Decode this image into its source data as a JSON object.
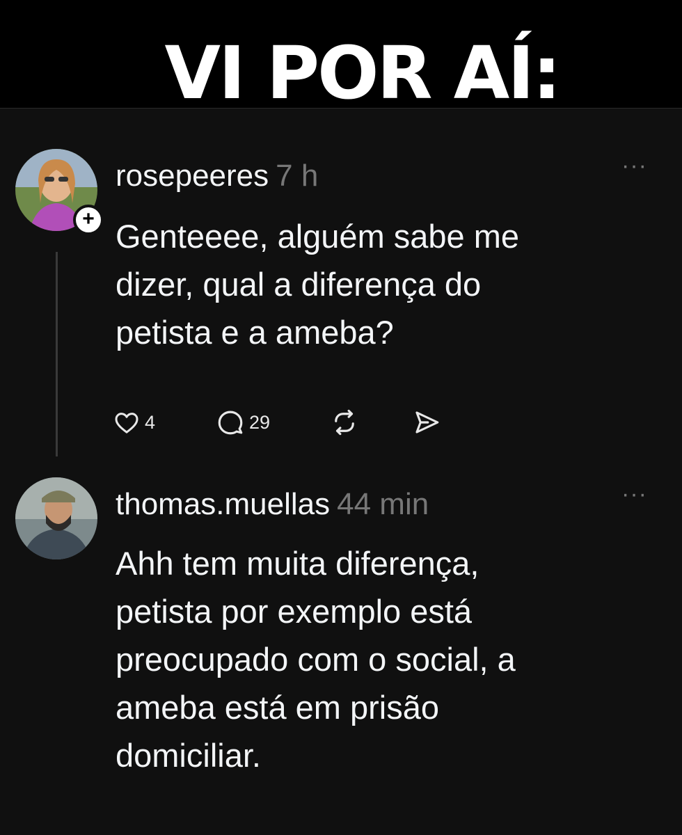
{
  "banner": {
    "title": "VI POR AÍ:"
  },
  "posts": [
    {
      "username": "rosepeeres",
      "time": "7 h",
      "text": "Genteeee, alguém sabe me dizer, qual a diferença do petista e a ameba?",
      "lines": [
        "Genteeee, alguém sabe me",
        "dizer, qual a diferença do",
        "petista e a ameba?"
      ],
      "likes": "4",
      "replies": "29",
      "follow_badge": "+",
      "more": "···"
    },
    {
      "username": "thomas.muellas",
      "time": "44 min",
      "lines": [
        "Ahh tem muita diferença,",
        "petista por exemplo está",
        "preocupado com o social, a",
        "ameba está em prisão",
        "domiciliar."
      ],
      "more": "···"
    }
  ],
  "icons": [
    "heart-icon",
    "comment-icon",
    "repost-icon",
    "share-icon",
    "more-icon",
    "follow-plus-icon"
  ],
  "colors": {
    "background": "#101010",
    "banner": "#000000",
    "muted": "#777777",
    "text": "#f3f5f7"
  }
}
